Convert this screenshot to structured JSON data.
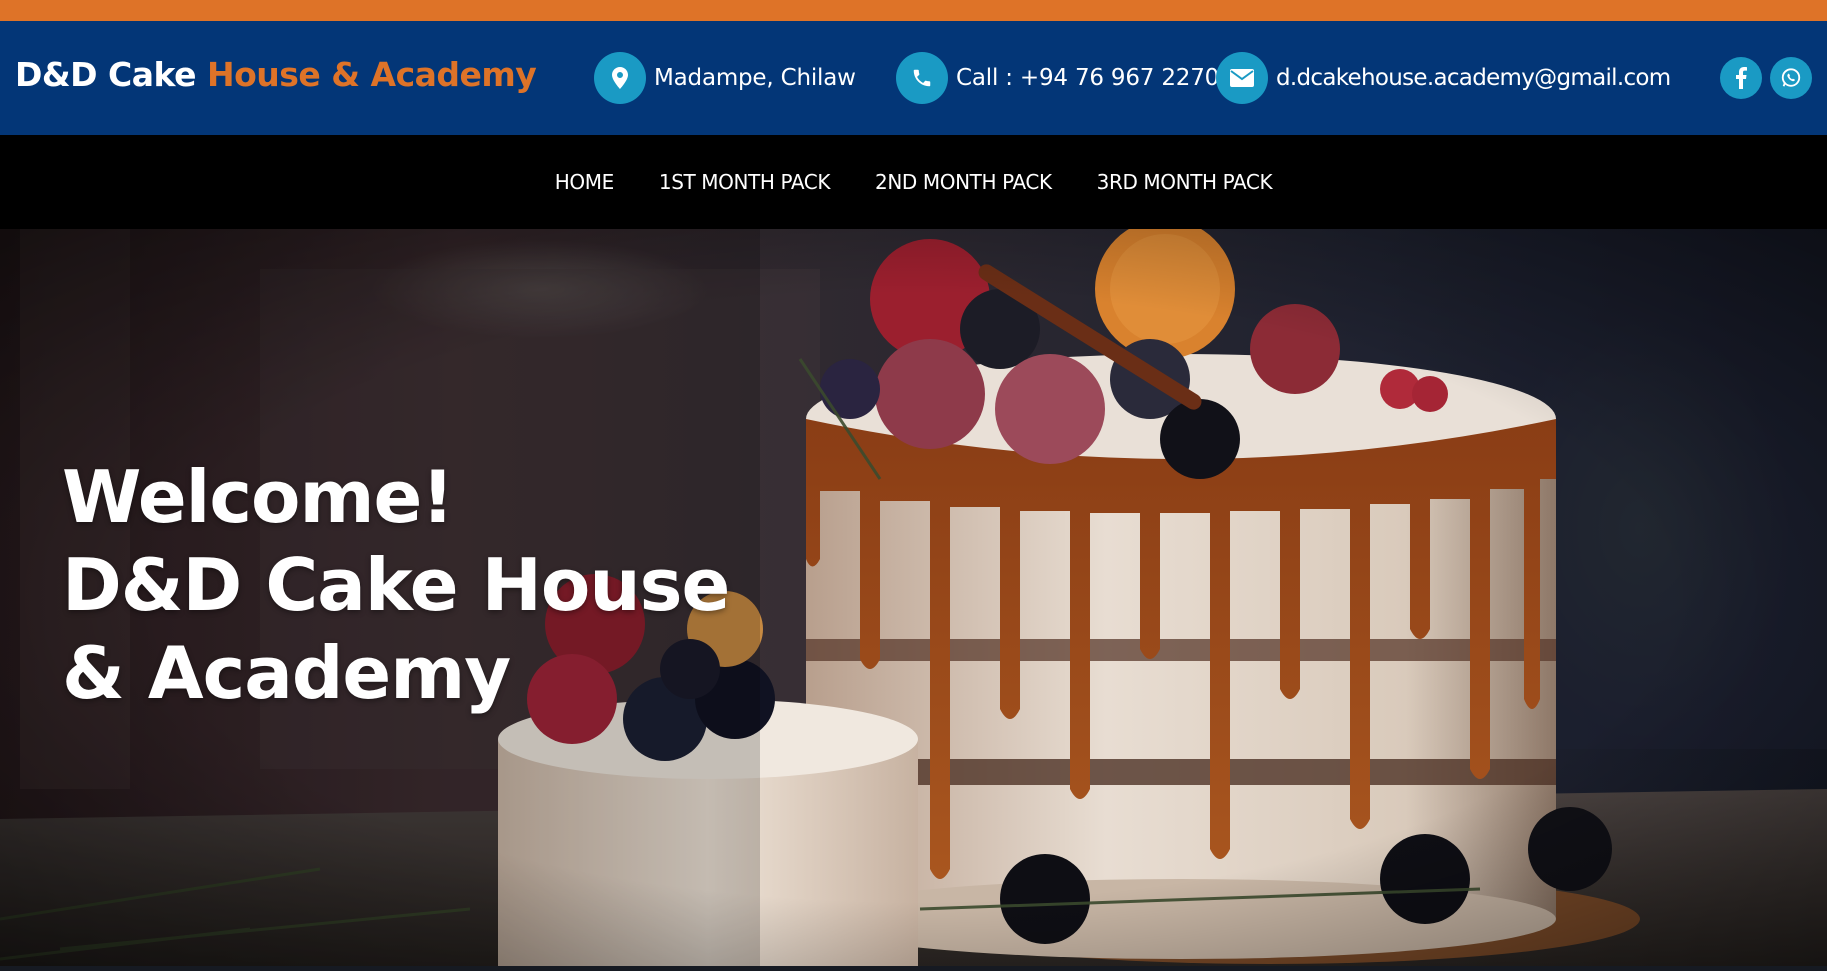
{
  "brand": {
    "part1": "D&D Cake",
    "part2": "House & Academy"
  },
  "contact": {
    "location": {
      "icon": "map-marker-icon",
      "text": "Madampe, Chilaw"
    },
    "phone": {
      "icon": "phone-icon",
      "text": "Call : +94 76 967 2270"
    },
    "email": {
      "icon": "envelope-icon",
      "text": "d.dcakehouse.academy@gmail.com"
    }
  },
  "social": {
    "facebook_icon": "facebook-icon",
    "whatsapp_icon": "whatsapp-icon"
  },
  "nav": {
    "items": [
      {
        "label": "HOME"
      },
      {
        "label": "1ST MONTH PACK"
      },
      {
        "label": "2ND MONTH PACK"
      },
      {
        "label": "3RD MONTH PACK"
      }
    ]
  },
  "hero": {
    "line1": "Welcome!",
    "line2": "D&D Cake House",
    "line3": "& Academy",
    "background_image": "drip-cake-with-berries"
  },
  "colors": {
    "accent_orange": "#de7328",
    "header_blue": "#033677",
    "icon_teal": "#1a9ac4",
    "nav_bg": "#000000"
  }
}
